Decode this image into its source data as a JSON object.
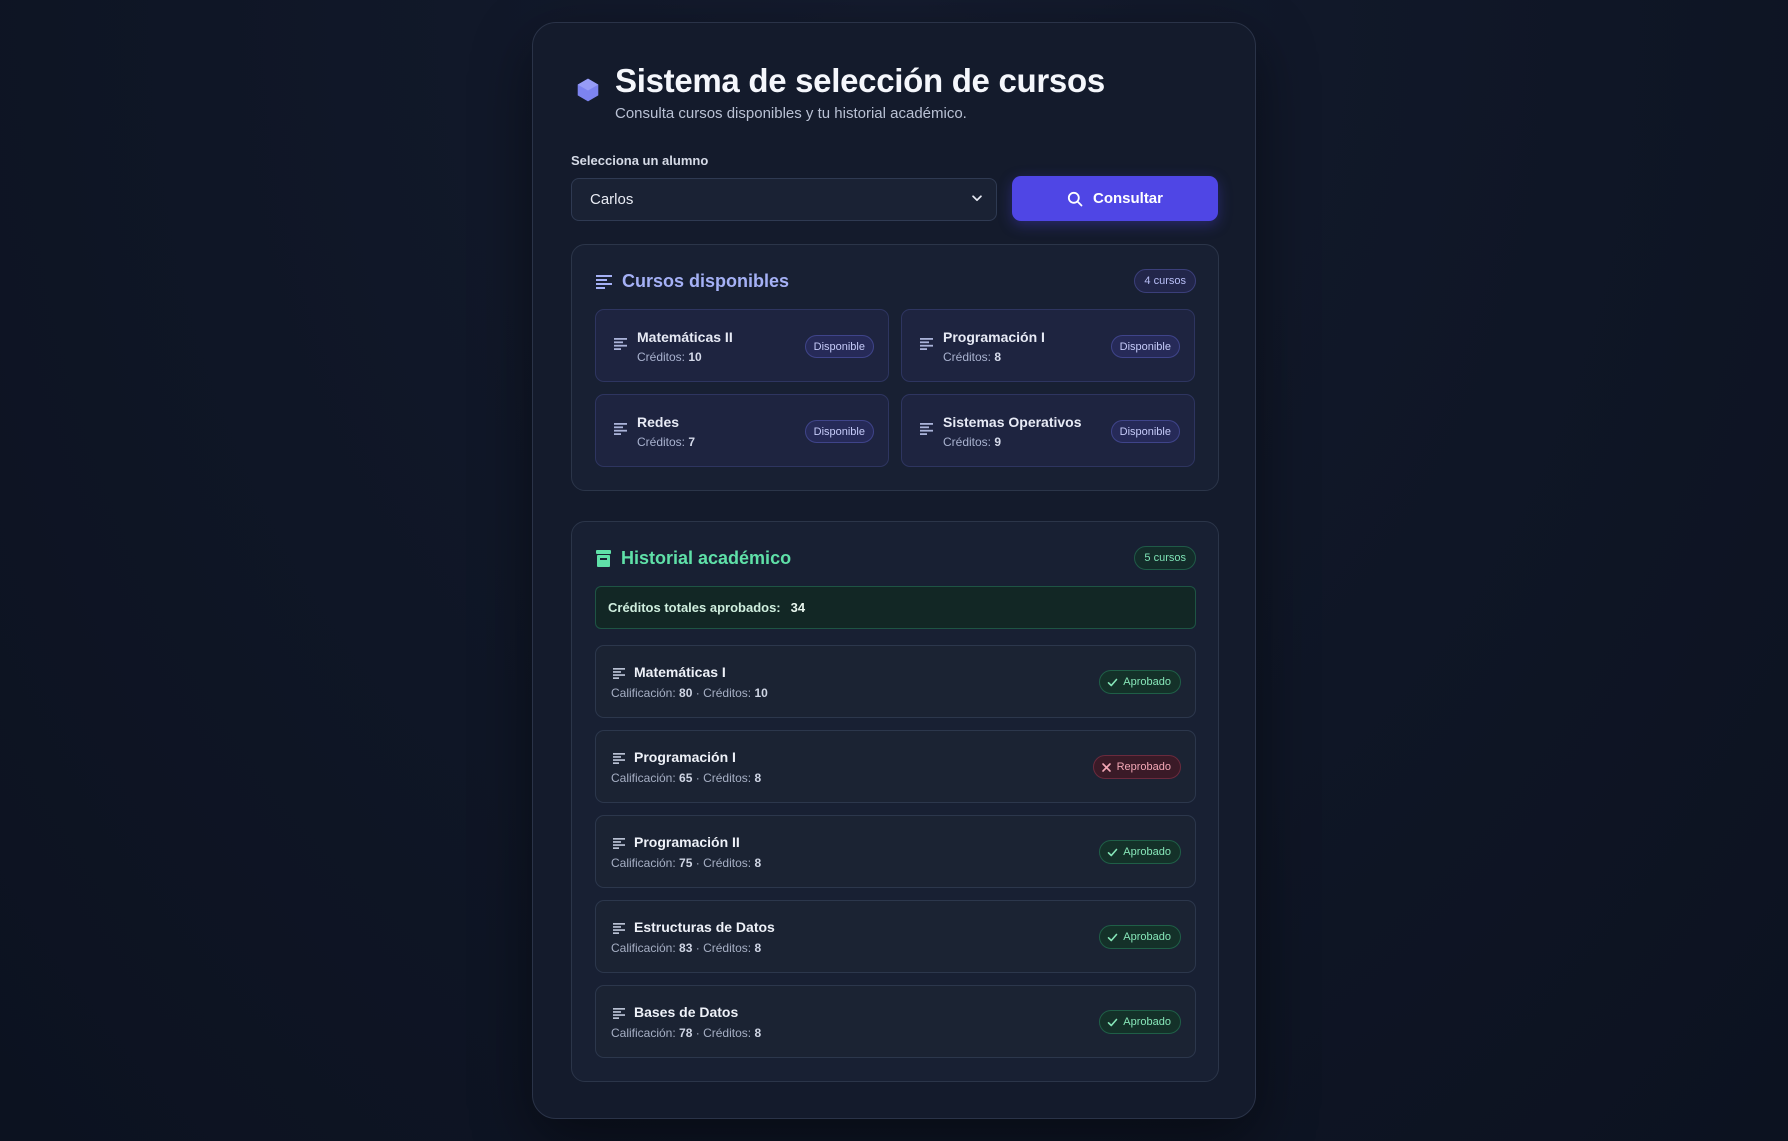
{
  "header": {
    "title": "Sistema de selección de cursos",
    "subtitle": "Consulta cursos disponibles y tu historial académico."
  },
  "form": {
    "label": "Selecciona un alumno",
    "selected_student": "Carlos",
    "button_label": "Consultar"
  },
  "available": {
    "title": "Cursos disponibles",
    "count": "4 cursos",
    "credits_label": "Créditos:",
    "courses": [
      {
        "name": "Matemáticas II",
        "credits": "10",
        "status": "Disponible"
      },
      {
        "name": "Programación I",
        "credits": "8",
        "status": "Disponible"
      },
      {
        "name": "Redes",
        "credits": "7",
        "status": "Disponible"
      },
      {
        "name": "Sistemas Operativos",
        "credits": "9",
        "status": "Disponible"
      }
    ]
  },
  "history": {
    "title": "Historial académico",
    "count": "5 cursos",
    "total_label": "Créditos totales aprobados:",
    "total_value": "34",
    "grade_label": "Calificación:",
    "credits_label": "Créditos:",
    "items": [
      {
        "name": "Matemáticas I",
        "grade": "80",
        "credits": "10",
        "status": "Aprobado"
      },
      {
        "name": "Programación I",
        "grade": "65",
        "credits": "8",
        "status": "Reprobado"
      },
      {
        "name": "Programación II",
        "grade": "75",
        "credits": "8",
        "status": "Aprobado"
      },
      {
        "name": "Estructuras de Datos",
        "grade": "83",
        "credits": "8",
        "status": "Aprobado"
      },
      {
        "name": "Bases de Datos",
        "grade": "78",
        "credits": "8",
        "status": "Aprobado"
      }
    ]
  },
  "colors": {
    "accent": "#4f46e5",
    "available_title": "#a5b1f6",
    "history_title": "#5fe0a8",
    "approved": "#86e6b8",
    "failed": "#f3a7b5"
  },
  "icons": {
    "logo": "hexagon-icon",
    "search": "search-icon",
    "course": "list-lines-icon",
    "history": "archive-icon",
    "approved": "check-icon",
    "failed": "x-icon",
    "select": "chevron-down-icon"
  }
}
